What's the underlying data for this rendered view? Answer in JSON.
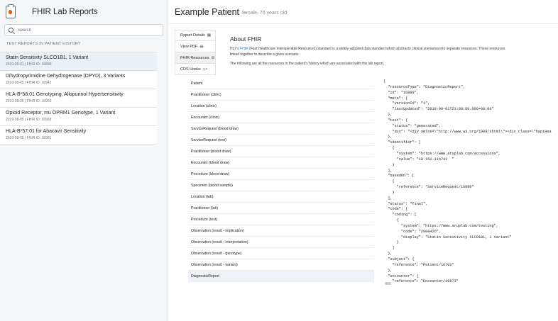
{
  "sidebar": {
    "title": "FHIR Lab Reports",
    "search_placeholder": "Search",
    "section_label": "TEST REPORTS IN PATIENT HISTORY",
    "reports": [
      {
        "name": "Statin Sensitivity SLCO1B1, 1 Variant",
        "meta": "2019-08-01 | FHIR ID: 16890"
      },
      {
        "name": "Dihydropyrimidine Dehydrogenase (DPYD), 3 Variants",
        "meta": "2019-08-05 | FHIR ID: 16942"
      },
      {
        "name": "HLA-B*58:01 Genotyping, Allopurinol Hypersensitivity",
        "meta": "2019-08-05 | FHIR ID: 16955"
      },
      {
        "name": "Opioid Receptor, mu OPRM1 Genotype, 1 Variant",
        "meta": "2019-08-05 | FHIR ID: 16968"
      },
      {
        "name": "HLA-B*57:01 for Abacavir Sensitivity",
        "meta": "2019-08-05 | FHIR ID: 16981"
      }
    ]
  },
  "patient": {
    "name": "Example Patient",
    "demographics": "female, 76 years old"
  },
  "tabs": [
    {
      "label": "Report Details",
      "icon": "▦"
    },
    {
      "label": "View PDF",
      "icon": "▤"
    },
    {
      "label": "FHIR Resources",
      "icon": "⊟"
    },
    {
      "label": "CDS Hooks",
      "icon": "<>"
    }
  ],
  "about": {
    "title": "About FHIR",
    "p1_pre": "HL7's ",
    "p1_link": "FHIR",
    "p1_post": " (Fast Healthcare Interoperable Resources) standard is a widely-adopted data standard which abstracts clinical scenarios into separate resources. These resources",
    "p1_line2": "linked together to describe a given scenario.",
    "p2": "The following are all the resources in the patient's history which are associated with this lab report."
  },
  "resources": [
    "Patient",
    "Practitioner (clinic)",
    "Location (clinic)",
    "Encounter (clinic)",
    "ServiceRequest (blood draw)",
    "ServiceRequest (test)",
    "Practitioner (blood draw)",
    "Encounter (blood draw)",
    "Procedure (blood draw)",
    "Specimen (blood sample)",
    "Location (lab)",
    "Practitioner (lab)",
    "Procedure (test)",
    "Observation (result - implication)",
    "Observation (result - interpretation)",
    "Observation (result - genotype)",
    "Observation (result - variant)",
    "DiagnosticReport"
  ],
  "json_lines": [
    "{",
    "  \"resourceType\": \"DiagnosticReport\",",
    "  \"id\": \"16890\",",
    "  \"meta\": {",
    "    \"versionId\": \"1\",",
    "    \"lastUpdated\": \"2019-08-01T23:09:50.000+00:00\"",
    "  },",
    "  \"text\": {",
    "    \"status\": \"generated\",",
    "    \"div\": \"<div xmlns=\\\"http://www.w3.org/1999/xhtml\\\"><div class=\\\"hapiHea",
    "  },",
    "  \"identifier\": [",
    "    {",
    "      \"system\": \"https://www.aruplab.com/accessions\",",
    "      \"value\": \"18-151-114742  \"",
    "    }",
    "  ],",
    "  \"basedOn\": [",
    "    {",
    "      \"reference\": \"ServiceRequest/16880\"",
    "    }",
    "  ],",
    "  \"status\": \"final\",",
    "  \"code\": {",
    "    \"coding\": [",
    "      {",
    "        \"system\": \"https://www.aruplab.com/testing\",",
    "        \"code\": \"2008426\",",
    "        \"display\": \"Statin Sensitivity SLCO1B1, 1 Variant\"",
    "      }",
    "    ]",
    "  },",
    "  \"subject\": {",
    "    \"reference\": \"Patient/16702\"",
    "  },",
    "  \"encounter\": {",
    "    \"reference\": \"Encounter/16873\""
  ]
}
